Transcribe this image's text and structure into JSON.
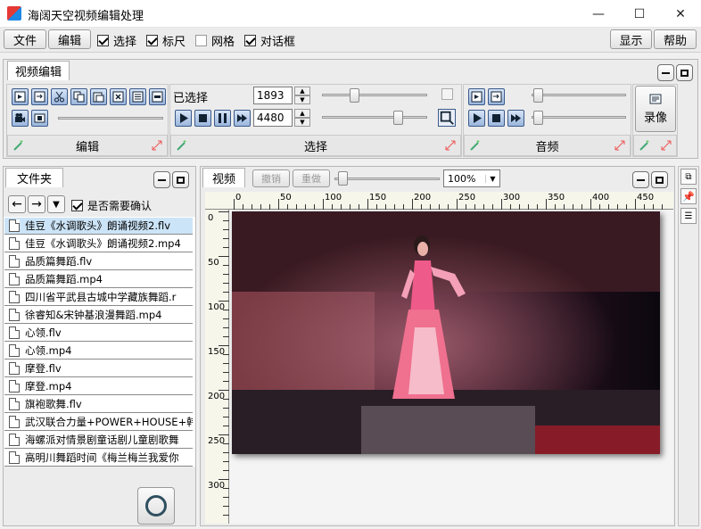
{
  "window": {
    "title": "海阔天空视频编辑处理",
    "min": "—",
    "max": "☐",
    "close": "✕"
  },
  "menu": {
    "file": "文件",
    "edit": "编辑",
    "checks": [
      {
        "label": "选择",
        "checked": true
      },
      {
        "label": "标尺",
        "checked": true
      },
      {
        "label": "网格",
        "checked": false
      },
      {
        "label": "对话框",
        "checked": true
      }
    ],
    "show": "显示",
    "help": "帮助"
  },
  "top_panel": {
    "tab": "视频编辑",
    "groups": {
      "edit": "编辑",
      "select": "选择",
      "audio": "音频"
    },
    "selected_label": "已选择",
    "spin1": "1893",
    "spin2": "4480",
    "record": "录像"
  },
  "folder": {
    "tab": "文件夹",
    "confirm_label": "是否需要确认",
    "confirm_checked": true,
    "files": [
      "佳豆《水调歌头》朗诵视频2.flv",
      "佳豆《水调歌头》朗诵视频2.mp4",
      "品质篇舞蹈.flv",
      "品质篇舞蹈.mp4",
      "四川省平武县古城中学藏族舞蹈.r",
      "徐睿知&宋钟基浪漫舞蹈.mp4",
      "心领.flv",
      "心领.mp4",
      "摩登.flv",
      "摩登.mp4",
      "旗袍歌舞.flv",
      "武汉联合力量+POWER+HOUSE+韩舞",
      "海螺派对情景剧童话剧儿童剧歌舞",
      "高明川舞蹈时间《梅兰梅兰我爱你"
    ]
  },
  "video": {
    "tab": "视频",
    "undo": "撤销",
    "redo": "重做",
    "zoom": "100%",
    "hruler": [
      "0",
      "50",
      "100",
      "150",
      "200",
      "250",
      "300",
      "350",
      "400",
      "450"
    ],
    "vruler": [
      "0",
      "50",
      "100",
      "150",
      "200",
      "250",
      "300"
    ]
  },
  "colors": {
    "accent": "#3b5a8a",
    "selection": "#cce4f7"
  }
}
